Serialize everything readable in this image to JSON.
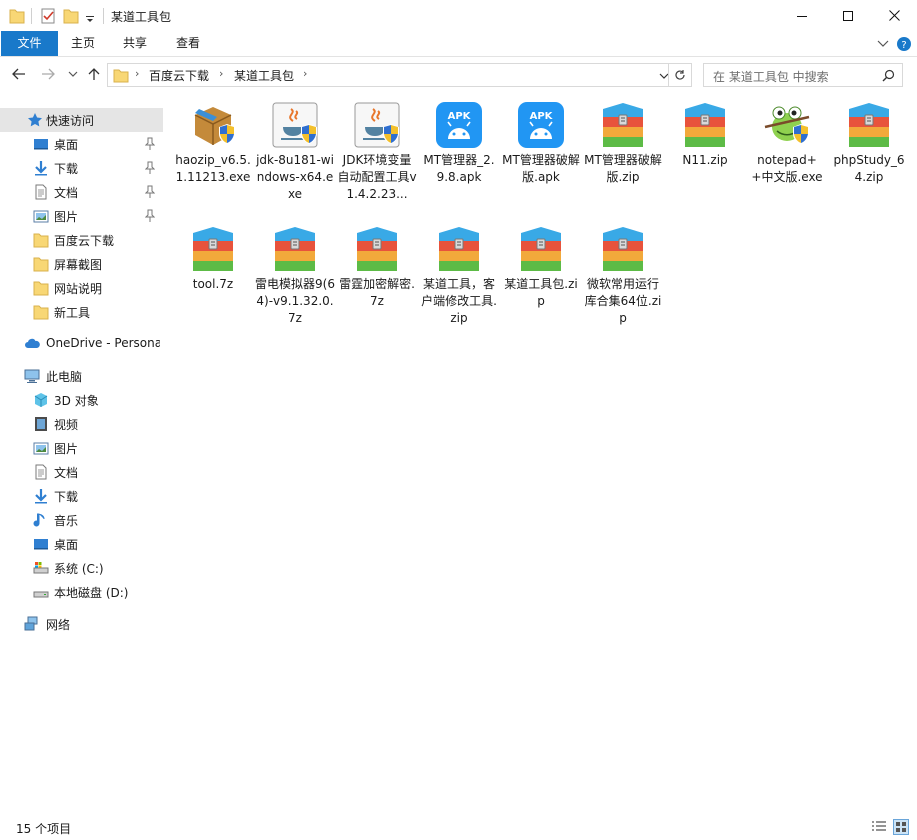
{
  "window": {
    "title": "某道工具包",
    "controls": [
      "minimize-icon",
      "maximize-icon",
      "close-icon"
    ]
  },
  "ribbon": {
    "tabs": [
      "文件",
      "主页",
      "共享",
      "查看"
    ]
  },
  "address": {
    "breadcrumbs": [
      "百度云下载",
      "某道工具包"
    ],
    "search_placeholder": "在 某道工具包 中搜索"
  },
  "nav": {
    "quick_access_label": "快速访问",
    "quick_items": [
      {
        "label": "桌面",
        "icon": "desktop-icon",
        "pinned": true
      },
      {
        "label": "下载",
        "icon": "download-icon",
        "pinned": true
      },
      {
        "label": "文档",
        "icon": "document-icon",
        "pinned": true
      },
      {
        "label": "图片",
        "icon": "picture-icon",
        "pinned": true
      },
      {
        "label": "百度云下载",
        "icon": "folder-icon",
        "pinned": false
      },
      {
        "label": "屏幕截图",
        "icon": "folder-icon",
        "pinned": false
      },
      {
        "label": "网站说明",
        "icon": "folder-icon",
        "pinned": false
      },
      {
        "label": "新工具",
        "icon": "folder-icon",
        "pinned": false
      }
    ],
    "onedrive_label": "OneDrive - Persona",
    "this_pc_label": "此电脑",
    "pc_items": [
      {
        "label": "3D 对象",
        "icon": "cube-icon"
      },
      {
        "label": "视频",
        "icon": "video-icon"
      },
      {
        "label": "图片",
        "icon": "picture-icon"
      },
      {
        "label": "文档",
        "icon": "document-icon"
      },
      {
        "label": "下载",
        "icon": "download-icon"
      },
      {
        "label": "音乐",
        "icon": "music-icon"
      },
      {
        "label": "桌面",
        "icon": "desktop-icon"
      },
      {
        "label": "系统 (C:)",
        "icon": "drive-icon"
      },
      {
        "label": "本地磁盘 (D:)",
        "icon": "drive-icon"
      }
    ],
    "network_label": "网络"
  },
  "files": [
    {
      "name": "haozip_v6.5.1.11213.exe",
      "icon": "installer-box-icon"
    },
    {
      "name": "jdk-8u181-windows-x64.exe",
      "icon": "java-installer-icon"
    },
    {
      "name": "JDK环境变量自动配置工具v1.4.2.23...",
      "icon": "java-installer-icon"
    },
    {
      "name": "MT管理器_2.9.8.apk",
      "icon": "apk-icon"
    },
    {
      "name": "MT管理器破解版.apk",
      "icon": "apk-icon"
    },
    {
      "name": "MT管理器破解版.zip",
      "icon": "archive-icon"
    },
    {
      "name": "N11.zip",
      "icon": "archive-icon"
    },
    {
      "name": "notepad++中文版.exe",
      "icon": "notepad-plus-icon"
    },
    {
      "name": "phpStudy_64.zip",
      "icon": "archive-icon"
    },
    {
      "name": "tool.7z",
      "icon": "archive-icon"
    },
    {
      "name": "雷电模拟器9(64)-v9.1.32.0.7z",
      "icon": "archive-icon"
    },
    {
      "name": "雷霆加密解密.7z",
      "icon": "archive-icon"
    },
    {
      "name": "某道工具，客户端修改工具.zip",
      "icon": "archive-icon"
    },
    {
      "name": "某道工具包.zip",
      "icon": "archive-icon"
    },
    {
      "name": "微软常用运行库合集64位.zip",
      "icon": "archive-icon"
    }
  ],
  "status": {
    "item_count": "15 个项目"
  },
  "colors": {
    "accent": "#1979ca",
    "folder": "#f8d775",
    "selection": "#e5e5e5"
  }
}
